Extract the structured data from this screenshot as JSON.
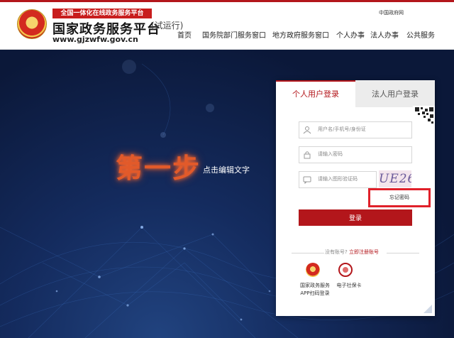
{
  "header": {
    "slogan": "全国一体化在线政务服务平台",
    "site_name": "国家政务服务平台",
    "site_url": "www.gjzwfw.gov.cn",
    "trial": "(试运行)",
    "gov_link": "中国政府网",
    "nav": [
      "首页",
      "国务院部门服务窗口",
      "地方政府服务窗口",
      "个人办事",
      "法人办事",
      "公共服务"
    ]
  },
  "hero": {
    "step_title": "第一步",
    "edit_hint": "点击编辑文字"
  },
  "login": {
    "tabs": [
      "个人用户登录",
      "法人用户登录"
    ],
    "username_placeholder": "用户名/手机号/身份证",
    "password_placeholder": "请输入密码",
    "captcha_placeholder": "请输入图形验证码",
    "captcha_text": "UE26",
    "forgot_label": "忘记密码",
    "login_label": "登录",
    "no_account": "没有账号?",
    "register_label": "立即注册账号",
    "app_label": "国家政务服务APP扫码登录",
    "social_label": "电子社保卡"
  },
  "colors": {
    "brand_red": "#b3161b",
    "highlight_red": "#e0202a",
    "step_orange": "#e25a2a",
    "hero_blue": "#142b5e"
  }
}
